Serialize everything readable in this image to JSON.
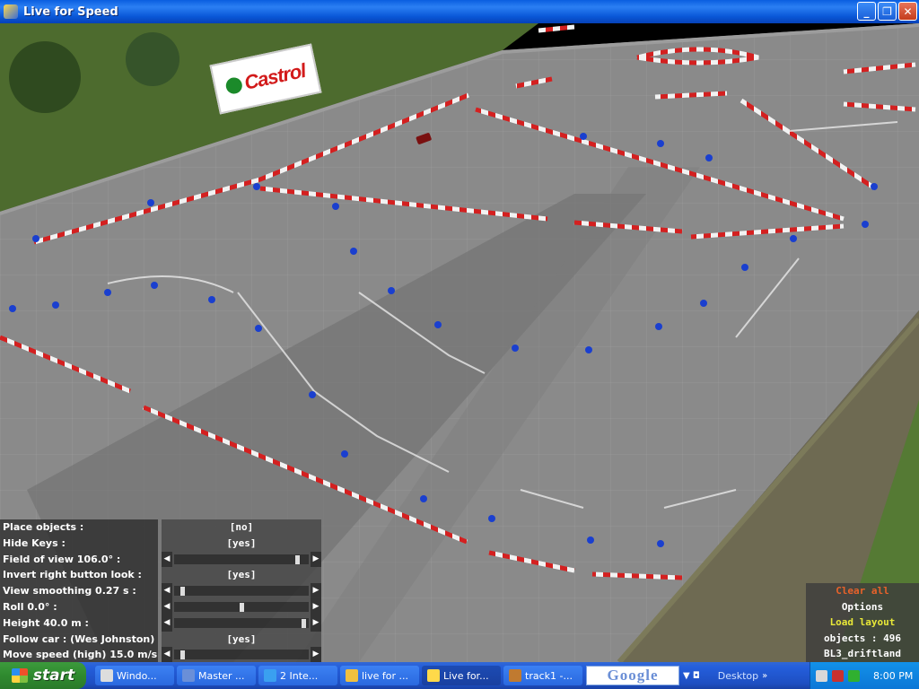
{
  "window": {
    "title": "Live for Speed",
    "controls": [
      "minimize-icon",
      "restore-icon",
      "close-icon"
    ]
  },
  "billboard": {
    "text": "Castrol"
  },
  "options_panel": [
    {
      "label": "Place objects :",
      "kind": "value",
      "value": "[no]"
    },
    {
      "label": "Hide Keys :",
      "kind": "value",
      "value": "[yes]"
    },
    {
      "label": "Field of view 106.0° :",
      "kind": "slider",
      "level": 0.93
    },
    {
      "label": "Invert right button look :",
      "kind": "value",
      "value": "[yes]"
    },
    {
      "label": "View smoothing 0.27 s :",
      "kind": "slider",
      "level": 0.05
    },
    {
      "label": "Roll 0.0° :",
      "kind": "slider",
      "level": 0.5
    },
    {
      "label": "Height 40.0 m :",
      "kind": "slider",
      "level": 0.98
    },
    {
      "label": "Follow car : (Wes Johnston)",
      "kind": "value",
      "value": "[yes]"
    },
    {
      "label": "Move speed (high) 15.0 m/s :",
      "kind": "slider",
      "level": 0.05
    }
  ],
  "right_panel": {
    "clear_all": "Clear all",
    "options": "Options",
    "load_layout": "Load layout",
    "objects": "objects : 496",
    "layout_name": "BL3_driftland",
    "colors": {
      "clear_all": "#e8622a",
      "load_layout": "#e8e838",
      "default": "#ffffff"
    }
  },
  "taskbar": {
    "start": "start",
    "tasks": [
      {
        "label": "Windo...",
        "icon": "window-icon"
      },
      {
        "label": "Master ...",
        "icon": "document-icon"
      },
      {
        "label": "2 Inte...",
        "icon": "ie-icon"
      },
      {
        "label": "live for ...",
        "icon": "folder-icon"
      },
      {
        "label": "Live for...",
        "icon": "lfs-icon",
        "active": true
      },
      {
        "label": "track1 -...",
        "icon": "paint-icon"
      }
    ],
    "google": "Google",
    "desktop": "Desktop",
    "clock": "8:00 PM"
  }
}
